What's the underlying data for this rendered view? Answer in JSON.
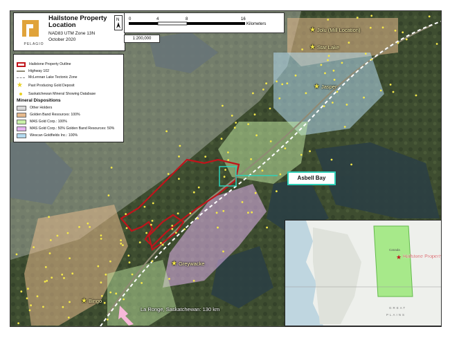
{
  "title": {
    "name": "Hailstone Property Location",
    "projection": "NAD83 UTM Zone 13N",
    "date": "October 2020",
    "logo_text": "PELAGIO"
  },
  "scale": {
    "ticks": [
      "0",
      "4",
      "8",
      "16"
    ],
    "unit": "Kilometers",
    "ratio": "1:200,000"
  },
  "north_arrow": {
    "label": "N"
  },
  "legend": {
    "items": [
      {
        "label": "Hailstone Property Outline",
        "color": "#c0141b",
        "type": "outline"
      },
      {
        "label": "Highway 102",
        "color": "#8f8a74",
        "type": "line"
      },
      {
        "label": "McLennan Lake Tectonic Zone",
        "color": "#ffffff",
        "type": "dashed"
      },
      {
        "label": "Past Producing Gold Deposit",
        "color": "#f4e84a",
        "type": "star"
      },
      {
        "label": "Saskatchewan Mineral Showing Database",
        "color": "#f4e84a",
        "type": "dot"
      }
    ],
    "dispositions_heading": "Mineral Dispositions",
    "dispositions": [
      {
        "label": "Other Holders",
        "color": "#d9d9d9"
      },
      {
        "label": "Golden Band Resources: 100%",
        "color": "#e6b98c"
      },
      {
        "label": "MAS Gold Corp.: 100%",
        "color": "#c8f0a8"
      },
      {
        "label": "MAS Gold Corp.: 50% Golden Band Resources: 50%",
        "color": "#e4b4f0"
      },
      {
        "label": "Wescan Goldfields Inc.: 100%",
        "color": "#b4daf0"
      }
    ]
  },
  "places": [
    {
      "name": "Jolu (Mill Location)",
      "icon": "star-icon"
    },
    {
      "name": "Star Lake",
      "icon": "star-icon"
    },
    {
      "name": "Jasper",
      "icon": "star-icon"
    },
    {
      "name": "Greywacke",
      "icon": "star-icon"
    },
    {
      "name": "Bingo",
      "icon": "star-icon"
    }
  ],
  "callout": {
    "label": "Asbell Bay",
    "color": "#2fd0b8"
  },
  "direction": {
    "label": "La Ronge, Saskatchewan: 130 km",
    "icon": "arrow-icon",
    "color": "#f7b8d8"
  },
  "inset": {
    "property_label": "Hailstone Property",
    "labels": [
      "Canada",
      "GREAT",
      "PLAINS"
    ],
    "highlight_color": "#9be87a"
  },
  "colors": {
    "property_outline": "#c0141b",
    "dots": "#f4e84a",
    "tectonic_zone": "#ffffff"
  }
}
